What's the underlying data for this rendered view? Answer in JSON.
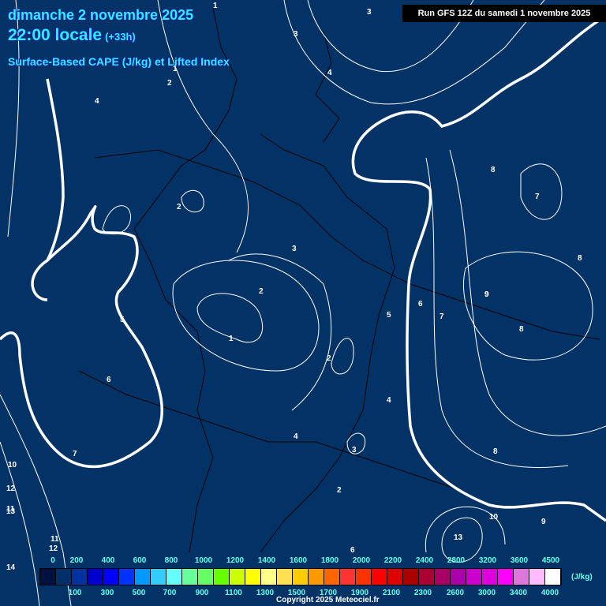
{
  "header": {
    "date": "dimanche 2 novembre 2025",
    "time": "22:00 locale",
    "lead": "(+33h)",
    "parameter": "Surface-Based CAPE (J/kg) et Lifted Index",
    "run": "Run GFS 12Z du samedi 1 novembre 2025"
  },
  "legend": {
    "unit": "(J/kg)",
    "colors": [
      "#001040",
      "#00306a",
      "#0033a0",
      "#0000cc",
      "#0000ff",
      "#0033ff",
      "#0099ff",
      "#33ccff",
      "#66ffff",
      "#66ff99",
      "#66ff66",
      "#66ff00",
      "#ccff00",
      "#ffff00",
      "#ffff88",
      "#ffe050",
      "#ffcc00",
      "#ff9900",
      "#ff6600",
      "#ff3333",
      "#ff3300",
      "#ff0000",
      "#dd0000",
      "#aa0000",
      "#aa0033",
      "#aa0066",
      "#aa00aa",
      "#cc00cc",
      "#dd00dd",
      "#ff00ff",
      "#dd77dd",
      "#ffbbff",
      "#ffffff"
    ],
    "top_labels": [
      "0",
      "200",
      "400",
      "600",
      "800",
      "1000",
      "1200",
      "1400",
      "1600",
      "1800",
      "2000",
      "2200",
      "2400",
      "2800",
      "3200",
      "3600",
      "4500"
    ],
    "bottom_labels": [
      "100",
      "300",
      "500",
      "700",
      "900",
      "1100",
      "1300",
      "1500",
      "1700",
      "1900",
      "2100",
      "2300",
      "2600",
      "3000",
      "3400",
      "4000"
    ]
  },
  "contour_labels": [
    "1",
    "2",
    "3",
    "4",
    "5",
    "6",
    "7",
    "8",
    "9",
    "10",
    "11",
    "12",
    "13",
    "14",
    "1",
    "2",
    "3",
    "4",
    "5",
    "6",
    "7",
    "8",
    "9",
    "3",
    "2",
    "4",
    "6",
    "8",
    "7",
    "8",
    "13",
    "10",
    "9",
    "11",
    "12",
    "3",
    "2",
    "2",
    "4",
    "1"
  ],
  "copyright": "Copyright 2025 Meteociel.fr"
}
